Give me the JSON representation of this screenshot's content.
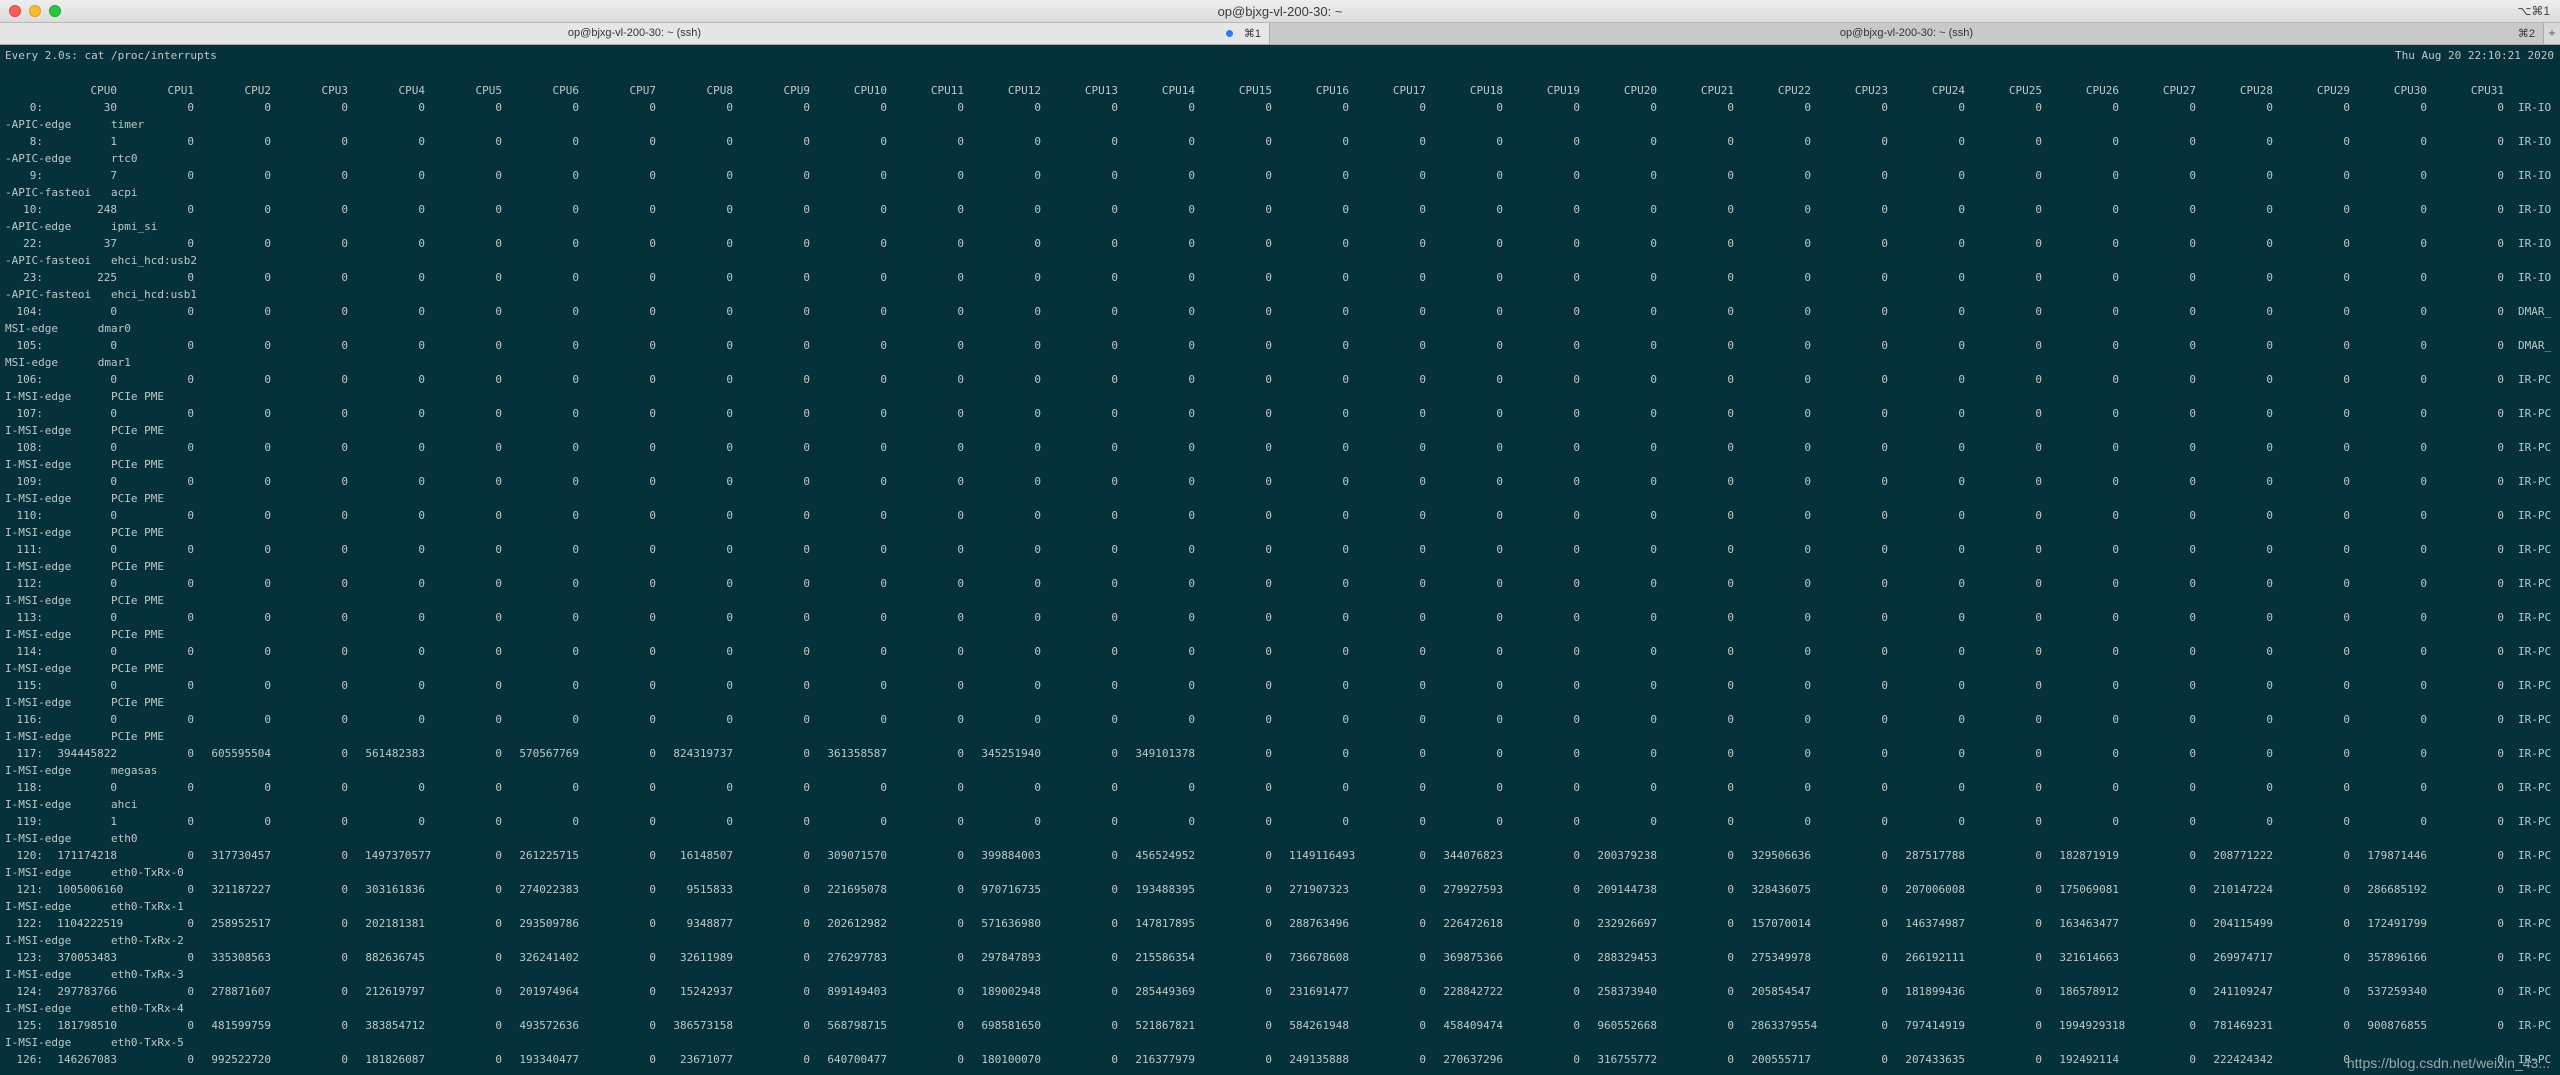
{
  "window": {
    "title": "op@bjxg-vl-200-30: ~",
    "shortcut": "⌥⌘1"
  },
  "tabs": [
    {
      "title": "op@bjxg-vl-200-30: ~ (ssh)",
      "shortcut": "⌘1",
      "active": true
    },
    {
      "title": "op@bjxg-vl-200-30: ~ (ssh)",
      "shortcut": "⌘2",
      "active": false
    }
  ],
  "new_tab": "+",
  "terminal": {
    "command": "Every 2.0s: cat /proc/interrupts",
    "timestamp": "Thu Aug 20 22:10:21 2020",
    "columns": [
      "CPU0",
      "CPU1",
      "CPU2",
      "CPU3",
      "CPU4",
      "CPU5",
      "CPU6",
      "CPU7",
      "CPU8",
      "CPU9",
      "CPU10",
      "CPU11",
      "CPU12",
      "CPU13",
      "CPU14",
      "CPU15",
      "CPU16",
      "CPU17",
      "CPU18",
      "CPU19",
      "CPU20",
      "CPU21",
      "CPU22",
      "CPU23",
      "CPU24",
      "CPU25",
      "CPU26",
      "CPU27",
      "CPU28",
      "CPU29",
      "CPU30",
      "CPU31"
    ],
    "rows": [
      {
        "irq": "0:",
        "vals": [
          "30",
          "0",
          "0",
          "0",
          "0",
          "0",
          "0",
          "0",
          "0",
          "0",
          "0",
          "0",
          "0",
          "0",
          "0",
          "0",
          "0",
          "0",
          "0",
          "0",
          "0",
          "0",
          "0",
          "0",
          "0",
          "0",
          "0",
          "0",
          "0",
          "0",
          "0",
          "0"
        ],
        "chip": "IR-IO",
        "wrap": "-APIC-edge      timer"
      },
      {
        "irq": "8:",
        "vals": [
          "1",
          "0",
          "0",
          "0",
          "0",
          "0",
          "0",
          "0",
          "0",
          "0",
          "0",
          "0",
          "0",
          "0",
          "0",
          "0",
          "0",
          "0",
          "0",
          "0",
          "0",
          "0",
          "0",
          "0",
          "0",
          "0",
          "0",
          "0",
          "0",
          "0",
          "0",
          "0"
        ],
        "chip": "IR-IO",
        "wrap": "-APIC-edge      rtc0"
      },
      {
        "irq": "9:",
        "vals": [
          "7",
          "0",
          "0",
          "0",
          "0",
          "0",
          "0",
          "0",
          "0",
          "0",
          "0",
          "0",
          "0",
          "0",
          "0",
          "0",
          "0",
          "0",
          "0",
          "0",
          "0",
          "0",
          "0",
          "0",
          "0",
          "0",
          "0",
          "0",
          "0",
          "0",
          "0",
          "0"
        ],
        "chip": "IR-IO",
        "wrap": "-APIC-fasteoi   acpi"
      },
      {
        "irq": "10:",
        "vals": [
          "248",
          "0",
          "0",
          "0",
          "0",
          "0",
          "0",
          "0",
          "0",
          "0",
          "0",
          "0",
          "0",
          "0",
          "0",
          "0",
          "0",
          "0",
          "0",
          "0",
          "0",
          "0",
          "0",
          "0",
          "0",
          "0",
          "0",
          "0",
          "0",
          "0",
          "0",
          "0"
        ],
        "chip": "IR-IO",
        "wrap": "-APIC-edge      ipmi_si"
      },
      {
        "irq": "22:",
        "vals": [
          "37",
          "0",
          "0",
          "0",
          "0",
          "0",
          "0",
          "0",
          "0",
          "0",
          "0",
          "0",
          "0",
          "0",
          "0",
          "0",
          "0",
          "0",
          "0",
          "0",
          "0",
          "0",
          "0",
          "0",
          "0",
          "0",
          "0",
          "0",
          "0",
          "0",
          "0",
          "0"
        ],
        "chip": "IR-IO",
        "wrap": "-APIC-fasteoi   ehci_hcd:usb2"
      },
      {
        "irq": "23:",
        "vals": [
          "225",
          "0",
          "0",
          "0",
          "0",
          "0",
          "0",
          "0",
          "0",
          "0",
          "0",
          "0",
          "0",
          "0",
          "0",
          "0",
          "0",
          "0",
          "0",
          "0",
          "0",
          "0",
          "0",
          "0",
          "0",
          "0",
          "0",
          "0",
          "0",
          "0",
          "0",
          "0"
        ],
        "chip": "IR-IO",
        "wrap": "-APIC-fasteoi   ehci_hcd:usb1"
      },
      {
        "irq": "104:",
        "vals": [
          "0",
          "0",
          "0",
          "0",
          "0",
          "0",
          "0",
          "0",
          "0",
          "0",
          "0",
          "0",
          "0",
          "0",
          "0",
          "0",
          "0",
          "0",
          "0",
          "0",
          "0",
          "0",
          "0",
          "0",
          "0",
          "0",
          "0",
          "0",
          "0",
          "0",
          "0",
          "0"
        ],
        "chip": "DMAR_",
        "wrap": "MSI-edge      dmar0"
      },
      {
        "irq": "105:",
        "vals": [
          "0",
          "0",
          "0",
          "0",
          "0",
          "0",
          "0",
          "0",
          "0",
          "0",
          "0",
          "0",
          "0",
          "0",
          "0",
          "0",
          "0",
          "0",
          "0",
          "0",
          "0",
          "0",
          "0",
          "0",
          "0",
          "0",
          "0",
          "0",
          "0",
          "0",
          "0",
          "0"
        ],
        "chip": "DMAR_",
        "wrap": "MSI-edge      dmar1"
      },
      {
        "irq": "106:",
        "vals": [
          "0",
          "0",
          "0",
          "0",
          "0",
          "0",
          "0",
          "0",
          "0",
          "0",
          "0",
          "0",
          "0",
          "0",
          "0",
          "0",
          "0",
          "0",
          "0",
          "0",
          "0",
          "0",
          "0",
          "0",
          "0",
          "0",
          "0",
          "0",
          "0",
          "0",
          "0",
          "0"
        ],
        "chip": "IR-PC",
        "wrap": "I-MSI-edge      PCIe PME"
      },
      {
        "irq": "107:",
        "vals": [
          "0",
          "0",
          "0",
          "0",
          "0",
          "0",
          "0",
          "0",
          "0",
          "0",
          "0",
          "0",
          "0",
          "0",
          "0",
          "0",
          "0",
          "0",
          "0",
          "0",
          "0",
          "0",
          "0",
          "0",
          "0",
          "0",
          "0",
          "0",
          "0",
          "0",
          "0",
          "0"
        ],
        "chip": "IR-PC",
        "wrap": "I-MSI-edge      PCIe PME"
      },
      {
        "irq": "108:",
        "vals": [
          "0",
          "0",
          "0",
          "0",
          "0",
          "0",
          "0",
          "0",
          "0",
          "0",
          "0",
          "0",
          "0",
          "0",
          "0",
          "0",
          "0",
          "0",
          "0",
          "0",
          "0",
          "0",
          "0",
          "0",
          "0",
          "0",
          "0",
          "0",
          "0",
          "0",
          "0",
          "0"
        ],
        "chip": "IR-PC",
        "wrap": "I-MSI-edge      PCIe PME"
      },
      {
        "irq": "109:",
        "vals": [
          "0",
          "0",
          "0",
          "0",
          "0",
          "0",
          "0",
          "0",
          "0",
          "0",
          "0",
          "0",
          "0",
          "0",
          "0",
          "0",
          "0",
          "0",
          "0",
          "0",
          "0",
          "0",
          "0",
          "0",
          "0",
          "0",
          "0",
          "0",
          "0",
          "0",
          "0",
          "0"
        ],
        "chip": "IR-PC",
        "wrap": "I-MSI-edge      PCIe PME"
      },
      {
        "irq": "110:",
        "vals": [
          "0",
          "0",
          "0",
          "0",
          "0",
          "0",
          "0",
          "0",
          "0",
          "0",
          "0",
          "0",
          "0",
          "0",
          "0",
          "0",
          "0",
          "0",
          "0",
          "0",
          "0",
          "0",
          "0",
          "0",
          "0",
          "0",
          "0",
          "0",
          "0",
          "0",
          "0",
          "0"
        ],
        "chip": "IR-PC",
        "wrap": "I-MSI-edge      PCIe PME"
      },
      {
        "irq": "111:",
        "vals": [
          "0",
          "0",
          "0",
          "0",
          "0",
          "0",
          "0",
          "0",
          "0",
          "0",
          "0",
          "0",
          "0",
          "0",
          "0",
          "0",
          "0",
          "0",
          "0",
          "0",
          "0",
          "0",
          "0",
          "0",
          "0",
          "0",
          "0",
          "0",
          "0",
          "0",
          "0",
          "0"
        ],
        "chip": "IR-PC",
        "wrap": "I-MSI-edge      PCIe PME"
      },
      {
        "irq": "112:",
        "vals": [
          "0",
          "0",
          "0",
          "0",
          "0",
          "0",
          "0",
          "0",
          "0",
          "0",
          "0",
          "0",
          "0",
          "0",
          "0",
          "0",
          "0",
          "0",
          "0",
          "0",
          "0",
          "0",
          "0",
          "0",
          "0",
          "0",
          "0",
          "0",
          "0",
          "0",
          "0",
          "0"
        ],
        "chip": "IR-PC",
        "wrap": "I-MSI-edge      PCIe PME"
      },
      {
        "irq": "113:",
        "vals": [
          "0",
          "0",
          "0",
          "0",
          "0",
          "0",
          "0",
          "0",
          "0",
          "0",
          "0",
          "0",
          "0",
          "0",
          "0",
          "0",
          "0",
          "0",
          "0",
          "0",
          "0",
          "0",
          "0",
          "0",
          "0",
          "0",
          "0",
          "0",
          "0",
          "0",
          "0",
          "0"
        ],
        "chip": "IR-PC",
        "wrap": "I-MSI-edge      PCIe PME"
      },
      {
        "irq": "114:",
        "vals": [
          "0",
          "0",
          "0",
          "0",
          "0",
          "0",
          "0",
          "0",
          "0",
          "0",
          "0",
          "0",
          "0",
          "0",
          "0",
          "0",
          "0",
          "0",
          "0",
          "0",
          "0",
          "0",
          "0",
          "0",
          "0",
          "0",
          "0",
          "0",
          "0",
          "0",
          "0",
          "0"
        ],
        "chip": "IR-PC",
        "wrap": "I-MSI-edge      PCIe PME"
      },
      {
        "irq": "115:",
        "vals": [
          "0",
          "0",
          "0",
          "0",
          "0",
          "0",
          "0",
          "0",
          "0",
          "0",
          "0",
          "0",
          "0",
          "0",
          "0",
          "0",
          "0",
          "0",
          "0",
          "0",
          "0",
          "0",
          "0",
          "0",
          "0",
          "0",
          "0",
          "0",
          "0",
          "0",
          "0",
          "0"
        ],
        "chip": "IR-PC",
        "wrap": "I-MSI-edge      PCIe PME"
      },
      {
        "irq": "116:",
        "vals": [
          "0",
          "0",
          "0",
          "0",
          "0",
          "0",
          "0",
          "0",
          "0",
          "0",
          "0",
          "0",
          "0",
          "0",
          "0",
          "0",
          "0",
          "0",
          "0",
          "0",
          "0",
          "0",
          "0",
          "0",
          "0",
          "0",
          "0",
          "0",
          "0",
          "0",
          "0",
          "0"
        ],
        "chip": "IR-PC",
        "wrap": "I-MSI-edge      PCIe PME"
      },
      {
        "irq": "117:",
        "vals": [
          "394445822",
          "0",
          "605595504",
          "0",
          "561482383",
          "0",
          "570567769",
          "0",
          "824319737",
          "0",
          "361358587",
          "0",
          "345251940",
          "0",
          "349101378",
          "0",
          "0",
          "0",
          "0",
          "0",
          "0",
          "0",
          "0",
          "0",
          "0",
          "0",
          "0",
          "0",
          "0",
          "0",
          "0",
          "0"
        ],
        "chip": "IR-PC",
        "wrap": "I-MSI-edge      megasas"
      },
      {
        "irq": "118:",
        "vals": [
          "0",
          "0",
          "0",
          "0",
          "0",
          "0",
          "0",
          "0",
          "0",
          "0",
          "0",
          "0",
          "0",
          "0",
          "0",
          "0",
          "0",
          "0",
          "0",
          "0",
          "0",
          "0",
          "0",
          "0",
          "0",
          "0",
          "0",
          "0",
          "0",
          "0",
          "0",
          "0"
        ],
        "chip": "IR-PC",
        "wrap": "I-MSI-edge      ahci"
      },
      {
        "irq": "119:",
        "vals": [
          "1",
          "0",
          "0",
          "0",
          "0",
          "0",
          "0",
          "0",
          "0",
          "0",
          "0",
          "0",
          "0",
          "0",
          "0",
          "0",
          "0",
          "0",
          "0",
          "0",
          "0",
          "0",
          "0",
          "0",
          "0",
          "0",
          "0",
          "0",
          "0",
          "0",
          "0",
          "0"
        ],
        "chip": "IR-PC",
        "wrap": "I-MSI-edge      eth0"
      },
      {
        "irq": "120:",
        "vals": [
          "171174218",
          "0",
          "317730457",
          "0",
          "1497370577",
          "0",
          "261225715",
          "0",
          "16148507",
          "0",
          "309071570",
          "0",
          "399884003",
          "0",
          "456524952",
          "0",
          "1149116493",
          "0",
          "344076823",
          "0",
          "200379238",
          "0",
          "329506636",
          "0",
          "287517788",
          "0",
          "182871919",
          "0",
          "208771222",
          "0",
          "179871446",
          "0"
        ],
        "chip": "IR-PC",
        "wrap": "I-MSI-edge      eth0-TxRx-0"
      },
      {
        "irq": "121:",
        "vals": [
          "1005006160",
          "0",
          "321187227",
          "0",
          "303161836",
          "0",
          "274022383",
          "0",
          "9515833",
          "0",
          "221695078",
          "0",
          "970716735",
          "0",
          "193488395",
          "0",
          "271907323",
          "0",
          "279927593",
          "0",
          "209144738",
          "0",
          "328436075",
          "0",
          "207006008",
          "0",
          "175069081",
          "0",
          "210147224",
          "0",
          "286685192",
          "0"
        ],
        "chip": "IR-PC",
        "wrap": "I-MSI-edge      eth0-TxRx-1"
      },
      {
        "irq": "122:",
        "vals": [
          "1104222519",
          "0",
          "258952517",
          "0",
          "202181381",
          "0",
          "293509786",
          "0",
          "9348877",
          "0",
          "202612982",
          "0",
          "571636980",
          "0",
          "147817895",
          "0",
          "288763496",
          "0",
          "226472618",
          "0",
          "232926697",
          "0",
          "157070014",
          "0",
          "146374987",
          "0",
          "163463477",
          "0",
          "204115499",
          "0",
          "172491799",
          "0"
        ],
        "chip": "IR-PC",
        "wrap": "I-MSI-edge      eth0-TxRx-2"
      },
      {
        "irq": "123:",
        "vals": [
          "370053483",
          "0",
          "335308563",
          "0",
          "882636745",
          "0",
          "326241402",
          "0",
          "32611989",
          "0",
          "276297783",
          "0",
          "297847893",
          "0",
          "215586354",
          "0",
          "736678608",
          "0",
          "369875366",
          "0",
          "288329453",
          "0",
          "275349978",
          "0",
          "266192111",
          "0",
          "321614663",
          "0",
          "269974717",
          "0",
          "357896166",
          "0"
        ],
        "chip": "IR-PC",
        "wrap": "I-MSI-edge      eth0-TxRx-3"
      },
      {
        "irq": "124:",
        "vals": [
          "297783766",
          "0",
          "278871607",
          "0",
          "212619797",
          "0",
          "201974964",
          "0",
          "15242937",
          "0",
          "899149403",
          "0",
          "189002948",
          "0",
          "285449369",
          "0",
          "231691477",
          "0",
          "228842722",
          "0",
          "258373940",
          "0",
          "205854547",
          "0",
          "181899436",
          "0",
          "186578912",
          "0",
          "241109247",
          "0",
          "537259340",
          "0"
        ],
        "chip": "IR-PC",
        "wrap": "I-MSI-edge      eth0-TxRx-4"
      },
      {
        "irq": "125:",
        "vals": [
          "181798510",
          "0",
          "481599759",
          "0",
          "383854712",
          "0",
          "493572636",
          "0",
          "386573158",
          "0",
          "568798715",
          "0",
          "698581650",
          "0",
          "521867821",
          "0",
          "584261948",
          "0",
          "458409474",
          "0",
          "960552668",
          "0",
          "2863379554",
          "0",
          "797414919",
          "0",
          "1994929318",
          "0",
          "781469231",
          "0",
          "900876855",
          "0"
        ],
        "chip": "IR-PC",
        "wrap": "I-MSI-edge      eth0-TxRx-5"
      },
      {
        "irq": "126:",
        "vals": [
          "146267083",
          "0",
          "992522720",
          "0",
          "181826087",
          "0",
          "193340477",
          "0",
          "23671077",
          "0",
          "640700477",
          "0",
          "180100070",
          "0",
          "216377979",
          "0",
          "249135888",
          "0",
          "270637296",
          "0",
          "316755772",
          "0",
          "200555717",
          "0",
          "207433635",
          "0",
          "192492114",
          "0",
          "222424342",
          "0",
          "",
          "0"
        ],
        "chip": "IR-PC",
        "wrap": ""
      }
    ]
  },
  "watermark": "https://blog.csdn.net/weixin_43..."
}
